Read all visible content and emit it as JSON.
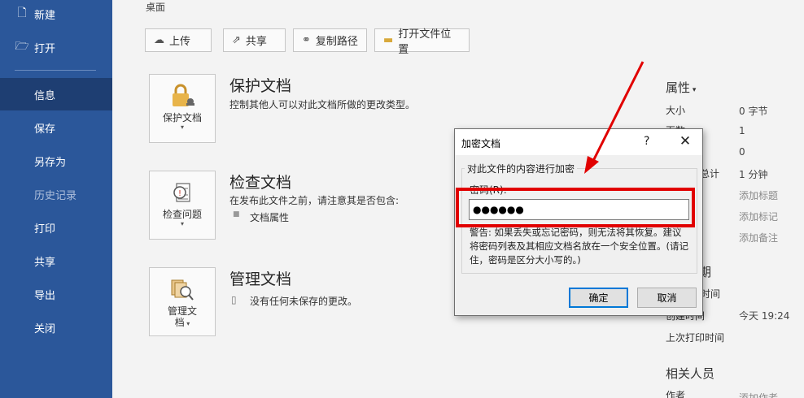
{
  "sidebar": {
    "new": "新建",
    "open": "打开",
    "info": "信息",
    "save": "保存",
    "save_as": "另存为",
    "history": "历史记录",
    "print": "打印",
    "share": "共享",
    "export": "导出",
    "close": "关闭"
  },
  "location": "桌面",
  "toolbar": {
    "upload": "上传",
    "share": "共享",
    "copy_path": "复制路径",
    "open_location": "打开文件位置"
  },
  "protect": {
    "button": "保护文档",
    "title": "保护文档",
    "desc": "控制其他人可以对此文档所做的更改类型。"
  },
  "inspect": {
    "button": "检查问题",
    "title": "检查文档",
    "desc": "在发布此文件之前，请注意其是否包含:",
    "item": "文档属性"
  },
  "manage": {
    "button_line1": "管理文",
    "button_line2": "档",
    "title": "管理文档",
    "desc": "没有任何未保存的更改。"
  },
  "properties": {
    "heading": "属性",
    "size_key": "大小",
    "size_val": "0 字节",
    "pages_key": "页数",
    "pages_val": "1",
    "words_val": "0",
    "edit_time_key": "总计",
    "edit_time_val": "1 分钟",
    "title_val": "添加标题",
    "tags_val": "添加标记",
    "comments_val": "添加备注",
    "dates_heading": "期",
    "modified_key": "时间",
    "created_key": "创建时间",
    "created_val": "今天 19:24",
    "printed_key": "上次打印时间",
    "people_heading": "相关人员",
    "author_key": "作者",
    "author_val": "添加作者"
  },
  "dialog": {
    "title": "加密文档",
    "help": "?",
    "group_label": "对此文件的内容进行加密",
    "password_label": "密码(R):",
    "password_value": "●●●●●●",
    "warning": "警告: 如果丢失或忘记密码，则无法将其恢复。建议将密码列表及其相应文档名放在一个安全位置。(请记住，密码是区分大小写的。)",
    "ok": "确定",
    "cancel": "取消"
  },
  "colors": {
    "sidebar": "#2b579a",
    "sidebar_active": "#1e3e72",
    "highlight": "#e10000",
    "default_button_border": "#0078d7"
  }
}
